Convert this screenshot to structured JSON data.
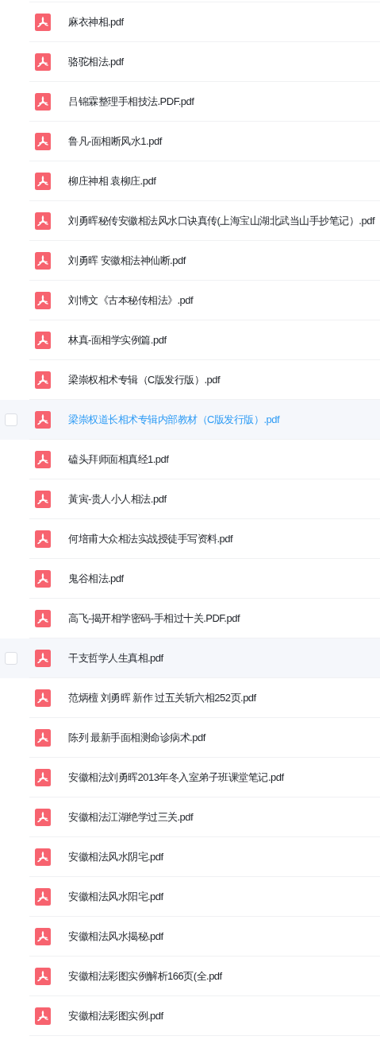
{
  "files": [
    {
      "name": "麻衣神相.pdf",
      "highlighted": false,
      "active": false
    },
    {
      "name": "骆驼相法.pdf",
      "highlighted": false,
      "active": false
    },
    {
      "name": "吕锦霖整理手相技法.PDF.pdf",
      "highlighted": false,
      "active": false
    },
    {
      "name": "鲁凡-面相断风水1.pdf",
      "highlighted": false,
      "active": false
    },
    {
      "name": "柳庄神相 袁柳庄.pdf",
      "highlighted": false,
      "active": false
    },
    {
      "name": "刘勇晖秘传安徽相法风水口诀真传(上海宝山湖北武当山手抄笔记）.pdf",
      "highlighted": false,
      "active": false
    },
    {
      "name": "刘勇晖 安徽相法神仙断.pdf",
      "highlighted": false,
      "active": false
    },
    {
      "name": "刘博文《古本秘传相法》.pdf",
      "highlighted": false,
      "active": false
    },
    {
      "name": "林真-面相学实例篇.pdf",
      "highlighted": false,
      "active": false
    },
    {
      "name": "梁崇权相术专辑（C版发行版）.pdf",
      "highlighted": false,
      "active": false
    },
    {
      "name": "梁崇权道长相术专辑内部教材（C版发行版）.pdf",
      "highlighted": true,
      "active": true
    },
    {
      "name": "磕头拜师面相真经1.pdf",
      "highlighted": false,
      "active": false
    },
    {
      "name": "黃寅-贵人小人相法.pdf",
      "highlighted": false,
      "active": false
    },
    {
      "name": "何培甫大众相法实战授徒手写资料.pdf",
      "highlighted": false,
      "active": false
    },
    {
      "name": "鬼谷相法.pdf",
      "highlighted": false,
      "active": false
    },
    {
      "name": "高飞-揭开相学密码-手相过十关.PDF.pdf",
      "highlighted": false,
      "active": false
    },
    {
      "name": "干支哲学人生真相.pdf",
      "highlighted": true,
      "active": false
    },
    {
      "name": "范炳檀 刘勇晖 新作 过五关斩六相252页.pdf",
      "highlighted": false,
      "active": false
    },
    {
      "name": "陈列 最新手面相测命诊病术.pdf",
      "highlighted": false,
      "active": false
    },
    {
      "name": "安徽相法刘勇晖2013年冬入室弟子班课堂笔记.pdf",
      "highlighted": false,
      "active": false
    },
    {
      "name": "安徽相法江湖绝学过三关.pdf",
      "highlighted": false,
      "active": false
    },
    {
      "name": "安徽相法风水阴宅.pdf",
      "highlighted": false,
      "active": false
    },
    {
      "name": "安徽相法风水阳宅.pdf",
      "highlighted": false,
      "active": false
    },
    {
      "name": "安徽相法风水揭秘.pdf",
      "highlighted": false,
      "active": false
    },
    {
      "name": "安徽相法彩图实例解析166页(全.pdf",
      "highlighted": false,
      "active": false
    },
    {
      "name": "安徽相法彩图实例.pdf",
      "highlighted": false,
      "active": false
    }
  ]
}
